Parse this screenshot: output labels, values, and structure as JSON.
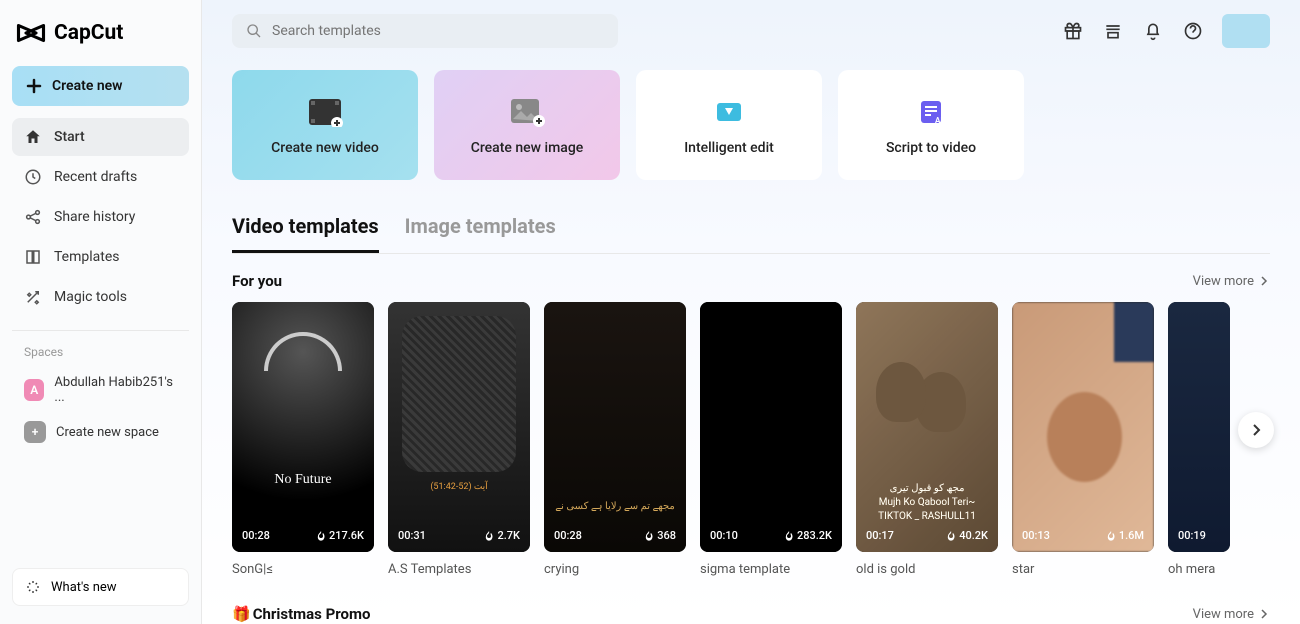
{
  "logo": "CapCut",
  "create_new": "Create new",
  "nav": {
    "start": "Start",
    "recent": "Recent drafts",
    "share": "Share history",
    "templates": "Templates",
    "magic": "Magic tools"
  },
  "spaces": {
    "label": "Spaces",
    "user": "Abdullah Habib251's ...",
    "new": "Create new space",
    "badge": "A",
    "plus": "+"
  },
  "whats_new": "What's new",
  "search": {
    "placeholder": "Search templates"
  },
  "actions": {
    "new_video": "Create new video",
    "new_image": "Create new image",
    "intelligent": "Intelligent edit",
    "script": "Script to video"
  },
  "tabs": {
    "video": "Video templates",
    "image": "Image templates"
  },
  "section": {
    "for_you": "For you",
    "view_more": "View more"
  },
  "promo": {
    "emoji": "🎁",
    "title": "Christmas Promo"
  },
  "templates_list": [
    {
      "duration": "00:28",
      "count": "217.6K",
      "name": "SonG|≤"
    },
    {
      "duration": "00:31",
      "count": "2.7K",
      "name": "A.S Templates"
    },
    {
      "duration": "00:28",
      "count": "368",
      "name": "crying"
    },
    {
      "duration": "00:10",
      "count": "283.2K",
      "name": "sigma template"
    },
    {
      "duration": "00:17",
      "count": "40.2K",
      "name": "old is gold"
    },
    {
      "duration": "00:13",
      "count": "1.6M",
      "name": "star"
    },
    {
      "duration": "00:19",
      "count": "",
      "name": "oh mera"
    }
  ]
}
